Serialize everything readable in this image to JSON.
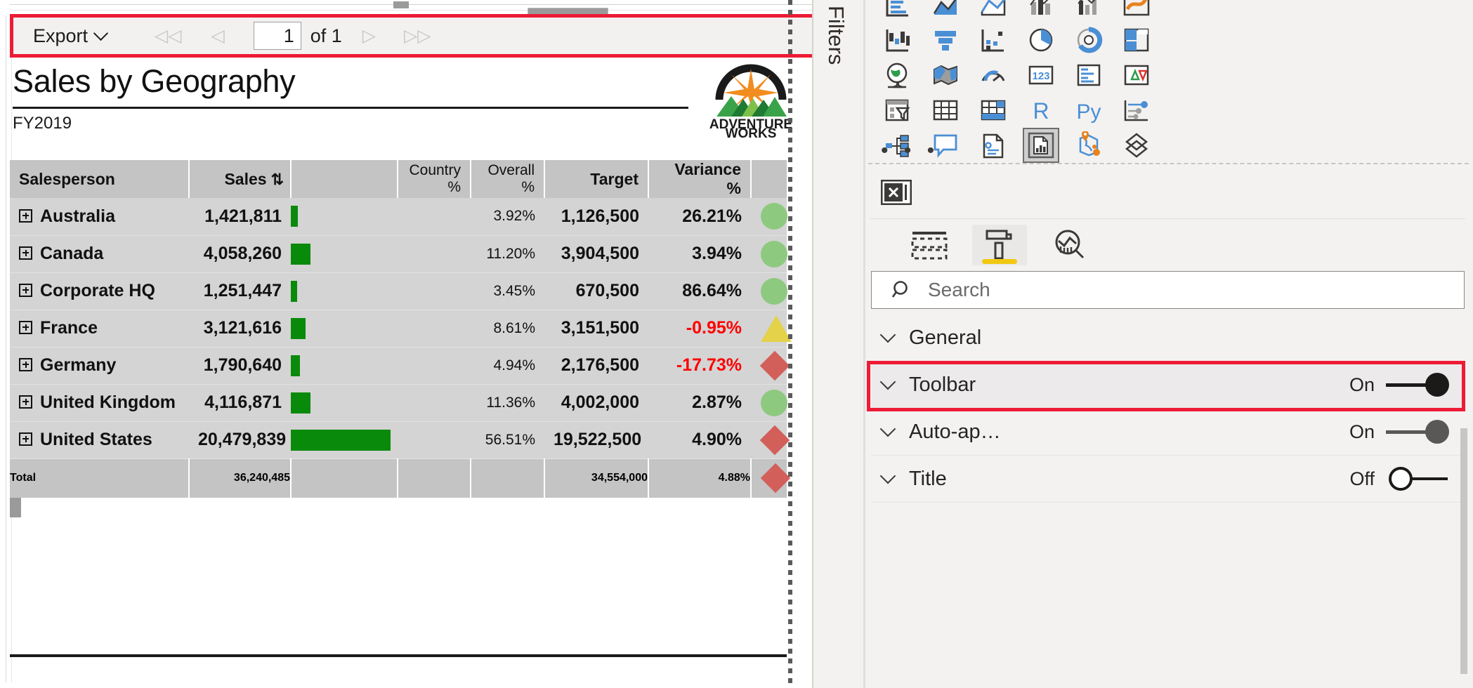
{
  "toolbar": {
    "export_label": "Export",
    "chevron_icon": "chevron-down-icon",
    "first_page_icon": "◁◁",
    "prev_page_icon": "◁",
    "next_page_icon": "▷",
    "last_page_icon": "▷▷",
    "page_value": "1",
    "page_of": "of 1"
  },
  "report": {
    "title": "Sales by Geography",
    "subtitle": "FY2019",
    "logo_line1": "ADVENTURE",
    "logo_line2": "WORKS"
  },
  "table": {
    "headers": [
      "Salesperson",
      "Sales",
      "",
      "Country %",
      "Overall %",
      "Target",
      "Variance %",
      ""
    ],
    "sort_icon": "⇅",
    "rows": [
      {
        "name": "Australia",
        "sales": "1,421,811",
        "bar_pct": 7,
        "country": "",
        "overall": "3.92%",
        "target": "1,126,500",
        "variance": "26.21%",
        "negative": false,
        "kpi": "circle"
      },
      {
        "name": "Canada",
        "sales": "4,058,260",
        "bar_pct": 20,
        "country": "",
        "overall": "11.20%",
        "target": "3,904,500",
        "variance": "3.94%",
        "negative": false,
        "kpi": "circle"
      },
      {
        "name": "Corporate HQ",
        "sales": "1,251,447",
        "bar_pct": 6,
        "country": "",
        "overall": "3.45%",
        "target": "670,500",
        "variance": "86.64%",
        "negative": false,
        "kpi": "circle"
      },
      {
        "name": "France",
        "sales": "3,121,616",
        "bar_pct": 15,
        "country": "",
        "overall": "8.61%",
        "target": "3,151,500",
        "variance": "-0.95%",
        "negative": true,
        "kpi": "triangle"
      },
      {
        "name": "Germany",
        "sales": "1,790,640",
        "bar_pct": 9,
        "country": "",
        "overall": "4.94%",
        "target": "2,176,500",
        "variance": "-17.73%",
        "negative": true,
        "kpi": "diamond"
      },
      {
        "name": "United Kingdom",
        "sales": "4,116,871",
        "bar_pct": 20,
        "country": "",
        "overall": "11.36%",
        "target": "4,002,000",
        "variance": "2.87%",
        "negative": false,
        "kpi": "circle"
      },
      {
        "name": "United States",
        "sales": "20,479,839",
        "bar_pct": 100,
        "country": "",
        "overall": "56.51%",
        "target": "19,522,500",
        "variance": "4.90%",
        "negative": false,
        "kpi": "diamond"
      }
    ],
    "total": {
      "name": "Total",
      "sales": "36,240,485",
      "country": "",
      "overall": "",
      "target": "34,554,000",
      "variance": "4.88%",
      "kpi": "diamond"
    },
    "bar_color": "#0a8a0a",
    "negative_color": "#ff0000",
    "header_bg": "#c4c4c4",
    "row_bg": "#d4d4d4"
  },
  "filters_pane": {
    "label": "Filters"
  },
  "visualizations": {
    "icons": [
      "stacked-bar-chart-icon",
      "stacked-area-chart-icon",
      "area-chart-icon",
      "line-and-stacked-column-chart-icon",
      "line-and-clustered-column-chart-icon",
      "ribbon-chart-icon",
      "waterfall-chart-icon",
      "funnel-chart-icon",
      "scatter-chart-icon",
      "pie-chart-icon",
      "donut-chart-icon",
      "treemap-icon",
      "globe-map-icon",
      "filled-map-icon",
      "gauge-icon",
      "card-icon",
      "multi-row-card-icon",
      "kpi-icon",
      "slicer-icon",
      "table-icon",
      "matrix-icon",
      "r-script-visual-icon",
      "python-visual-icon",
      "key-influencers-icon",
      "decomposition-tree-icon",
      "qna-icon",
      "smart-narrative-icon",
      "paginated-report-icon",
      "azure-map-icon",
      "get-more-visuals-icon"
    ],
    "more_label": "• • •",
    "selected_icon": "paginated-report-icon"
  },
  "format_pane": {
    "well_icon": "remove-field-icon",
    "tabs": [
      {
        "name": "fields-tab",
        "icon": "fields-icon",
        "active": false
      },
      {
        "name": "format-tab",
        "icon": "paint-roller-icon",
        "active": true
      },
      {
        "name": "analytics-tab",
        "icon": "analytics-magnifier-icon",
        "active": false
      }
    ],
    "search_placeholder": "Search",
    "search_icon": "search-icon",
    "items": [
      {
        "label": "General",
        "state": "",
        "toggle": "none",
        "highlighted": false
      },
      {
        "label": "Toolbar",
        "state": "On",
        "toggle": "on",
        "highlighted": true
      },
      {
        "label": "Auto-ap…",
        "state": "On",
        "toggle": "on-grey",
        "highlighted": false
      },
      {
        "label": "Title",
        "state": "Off",
        "toggle": "off",
        "highlighted": false
      }
    ]
  },
  "colors": {
    "highlight_red": "#ed1b35",
    "accent_yellow": "#f2c811",
    "pane_bg": "#f3f2f1",
    "toolbar_bg": "#f2f1f0"
  }
}
